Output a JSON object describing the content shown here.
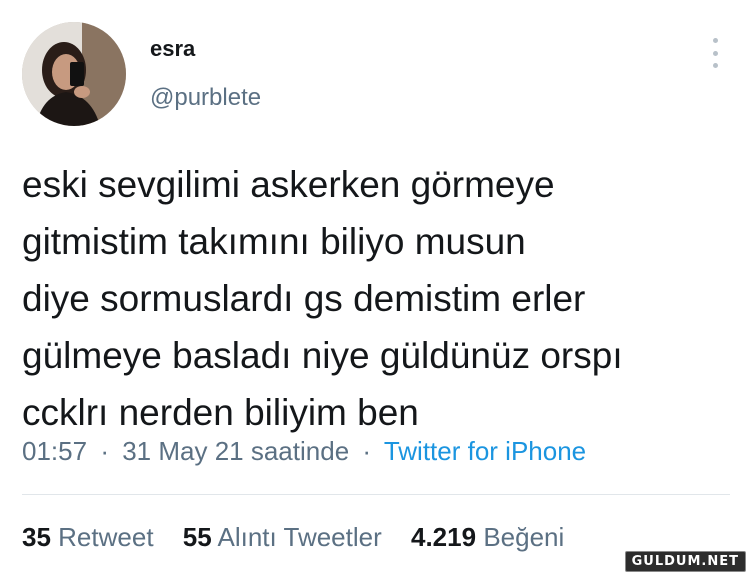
{
  "author": {
    "display_name": "esra",
    "handle": "@purblete",
    "avatar_icon": "profile-photo"
  },
  "tweet": {
    "lines": [
      "eski sevgilimi askerken görmeye",
      "gitmistim takımını biliyo musun",
      "diye sormuslardı gs demistim erler",
      "gülmeye basladı niye güldünüz orspı",
      "ccklrı nerden biliyim ben"
    ],
    "time": "01:57",
    "date": "31 May 21 saatinde",
    "separator": "·",
    "source": "Twitter for iPhone"
  },
  "stats": {
    "retweets_count": "35",
    "retweets_label": "Retweet",
    "quotes_count": "55",
    "quotes_label": "Alıntı Tweetler",
    "likes_count": "4.219",
    "likes_label": "Beğeni"
  },
  "watermark": "GULDUM.NET",
  "colors": {
    "text": "#14171a",
    "secondary": "#5b7083",
    "link": "#1b95e0",
    "divider": "#e1e6ea"
  }
}
